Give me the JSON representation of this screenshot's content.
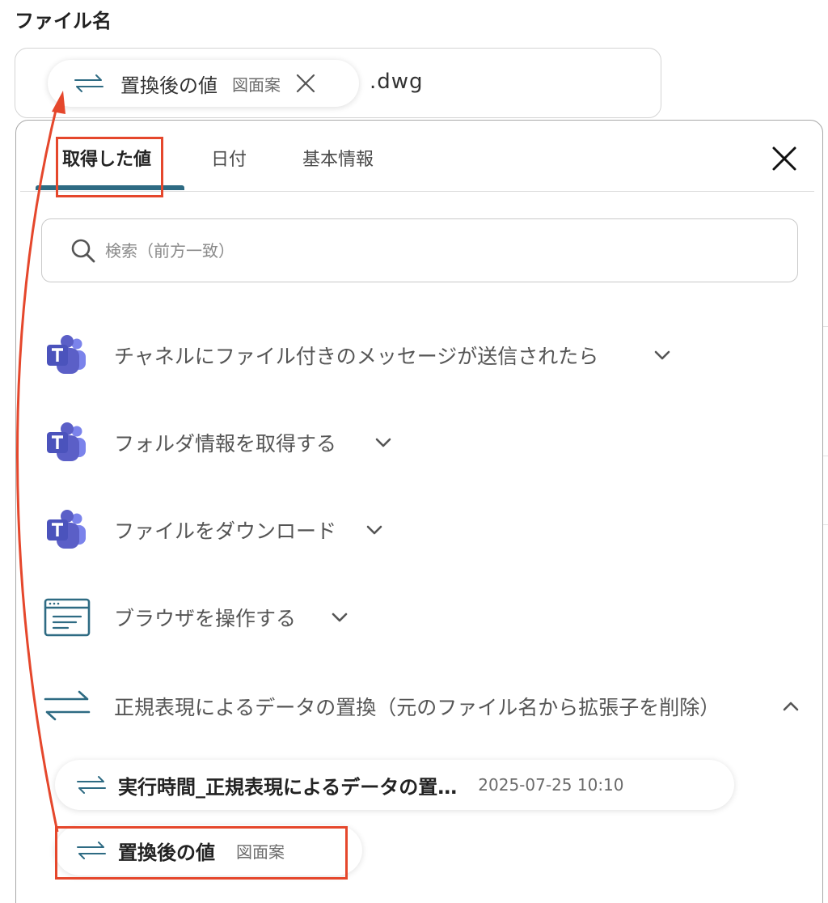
{
  "field": {
    "label": "ファイル名",
    "chip": {
      "name": "置換後の値",
      "subtitle": "図面案",
      "icon": "swap-arrows-icon"
    },
    "suffix": ".dwg"
  },
  "picker": {
    "tabs": [
      {
        "label": "取得した値",
        "active": true
      },
      {
        "label": "日付",
        "active": false
      },
      {
        "label": "基本情報",
        "active": false
      }
    ],
    "search": {
      "placeholder": "検索（前方一致）",
      "value": ""
    },
    "steps": [
      {
        "label": "チャネルにファイル付きのメッセージが送信されたら",
        "icon": "microsoft-teams-icon",
        "expanded": false
      },
      {
        "label": "フォルダ情報を取得する",
        "icon": "microsoft-teams-icon",
        "expanded": false
      },
      {
        "label": "ファイルをダウンロード",
        "icon": "microsoft-teams-icon",
        "expanded": false
      },
      {
        "label": "ブラウザを操作する",
        "icon": "browser-window-icon",
        "expanded": false
      },
      {
        "label": "正規表現によるデータの置換（元のファイル名から拡張子を削除）",
        "icon": "swap-arrows-icon",
        "expanded": true
      }
    ],
    "values": [
      {
        "name": "実行時間_正規表現によるデータの置…",
        "subtitle": "2025-07-25 10:10"
      },
      {
        "name": "置換後の値",
        "subtitle": "図面案"
      }
    ]
  },
  "colors": {
    "accent": "#2e6b83",
    "highlight": "#e5472c",
    "teams_purple": "#5b5fc7"
  }
}
